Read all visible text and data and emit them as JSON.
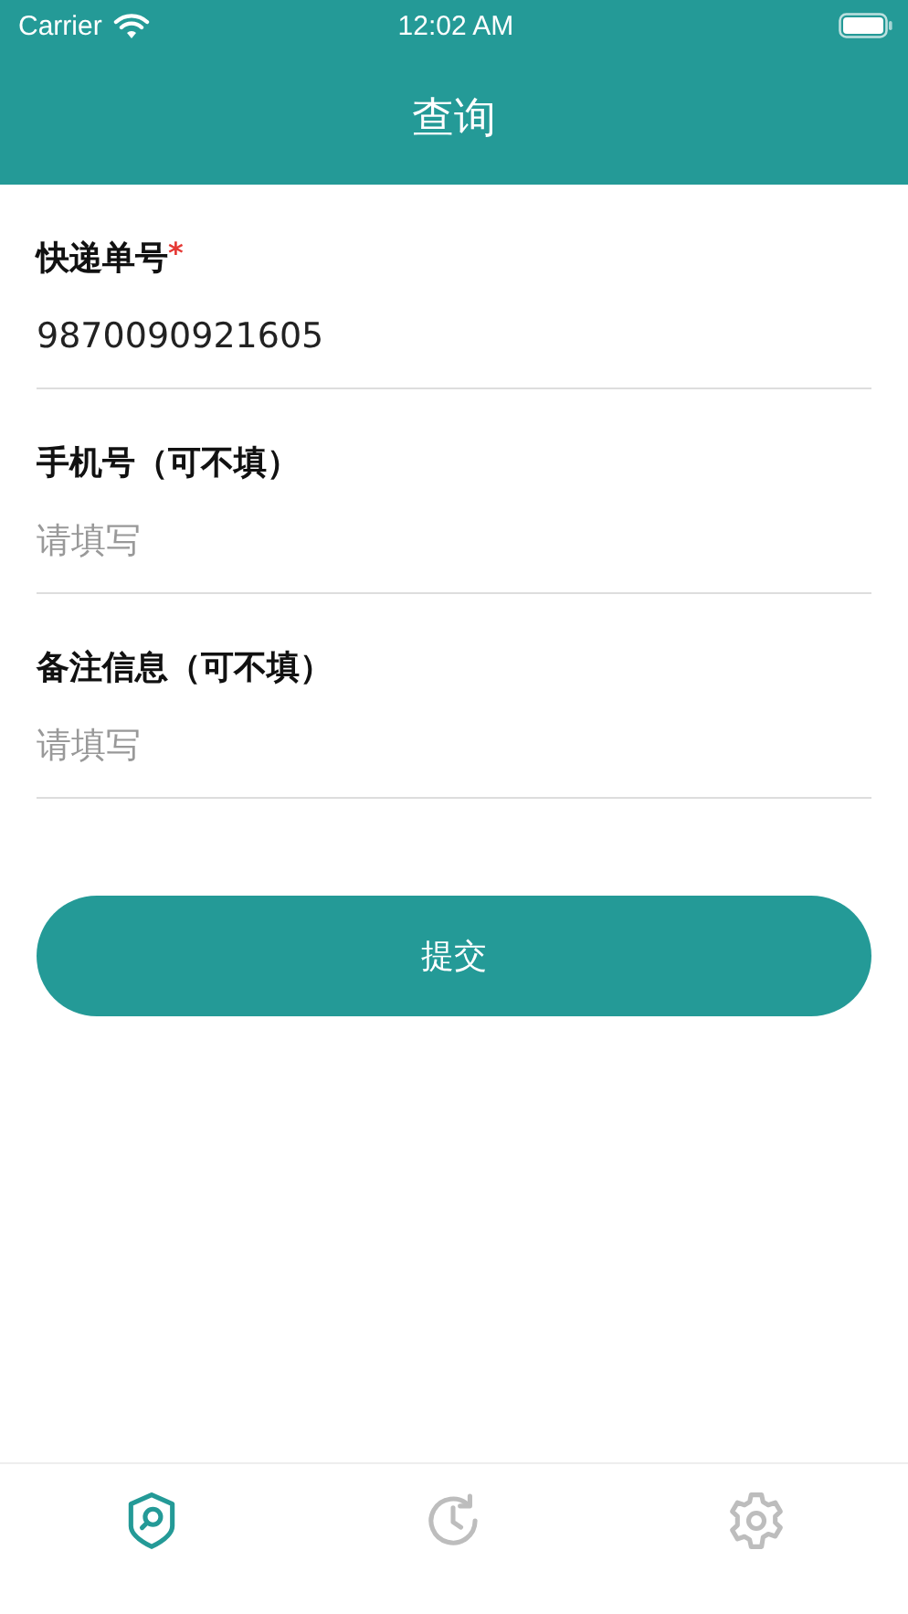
{
  "status_bar": {
    "carrier": "Carrier",
    "time": "12:02 AM"
  },
  "nav_bar": {
    "title": "查询"
  },
  "fields": [
    {
      "label": "快递单号",
      "required_mark": "*",
      "value": "9870090921605"
    },
    {
      "label": "手机号（可不填）",
      "placeholder": "请填写"
    },
    {
      "label": "备注信息（可不填）",
      "placeholder": "请填写"
    }
  ],
  "submit_button": {
    "label": "提交"
  },
  "tab_bar": [
    {
      "kind": "search",
      "selected": true
    },
    {
      "kind": "history",
      "selected": false
    },
    {
      "kind": "settings",
      "selected": false
    }
  ]
}
